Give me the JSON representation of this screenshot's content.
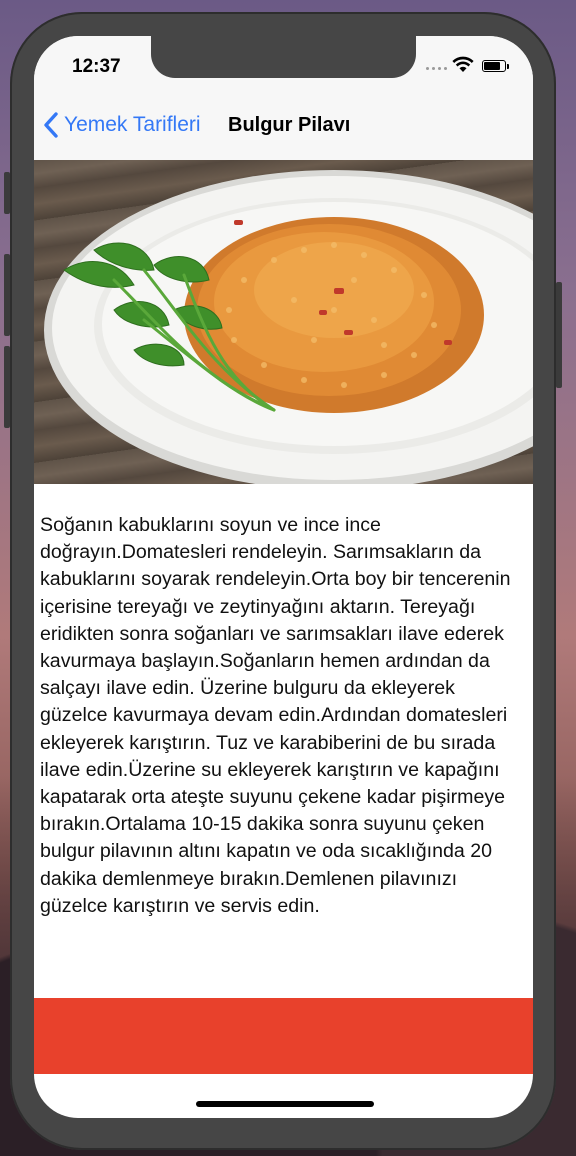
{
  "status_bar": {
    "time": "12:37"
  },
  "nav_bar": {
    "back_label": "Yemek Tarifleri",
    "title": "Bulgur Pilavı"
  },
  "recipe": {
    "image_icon": "food-photo",
    "instructions": "Soğanın kabuklarını soyun ve ince ince doğrayın.Domatesleri rendeleyin. Sarımsakların da kabuklarını soyarak rendeleyin.Orta boy bir tencerenin içerisine tereyağı ve zeytinyağını aktarın. Tereyağı eridikten sonra soğanları ve sarımsakları ilave ederek kavurmaya başlayın.Soğanların hemen ardından da salçayı ilave edin. Üzerine bulguru da ekleyerek güzelce kavurmaya devam edin.Ardından domatesleri ekleyerek karıştırın. Tuz ve karabiberini de bu sırada ilave edin.Üzerine su ekleyerek karıştırın ve kapağını kapatarak orta ateşte suyunu çekene kadar pişirmeye bırakın.Ortalama 10-15 dakika sonra suyunu çeken bulgur pilavının altını kapatın ve oda sıcaklığında 20 dakika demlenmeye bırakın.Demlenen pilavınızı güzelce karıştırın ve servis edin."
  },
  "colors": {
    "accent": "#3478f6",
    "banner": "#e8412c",
    "device_frame": "#464646",
    "nav_background": "#f7f7f7"
  }
}
